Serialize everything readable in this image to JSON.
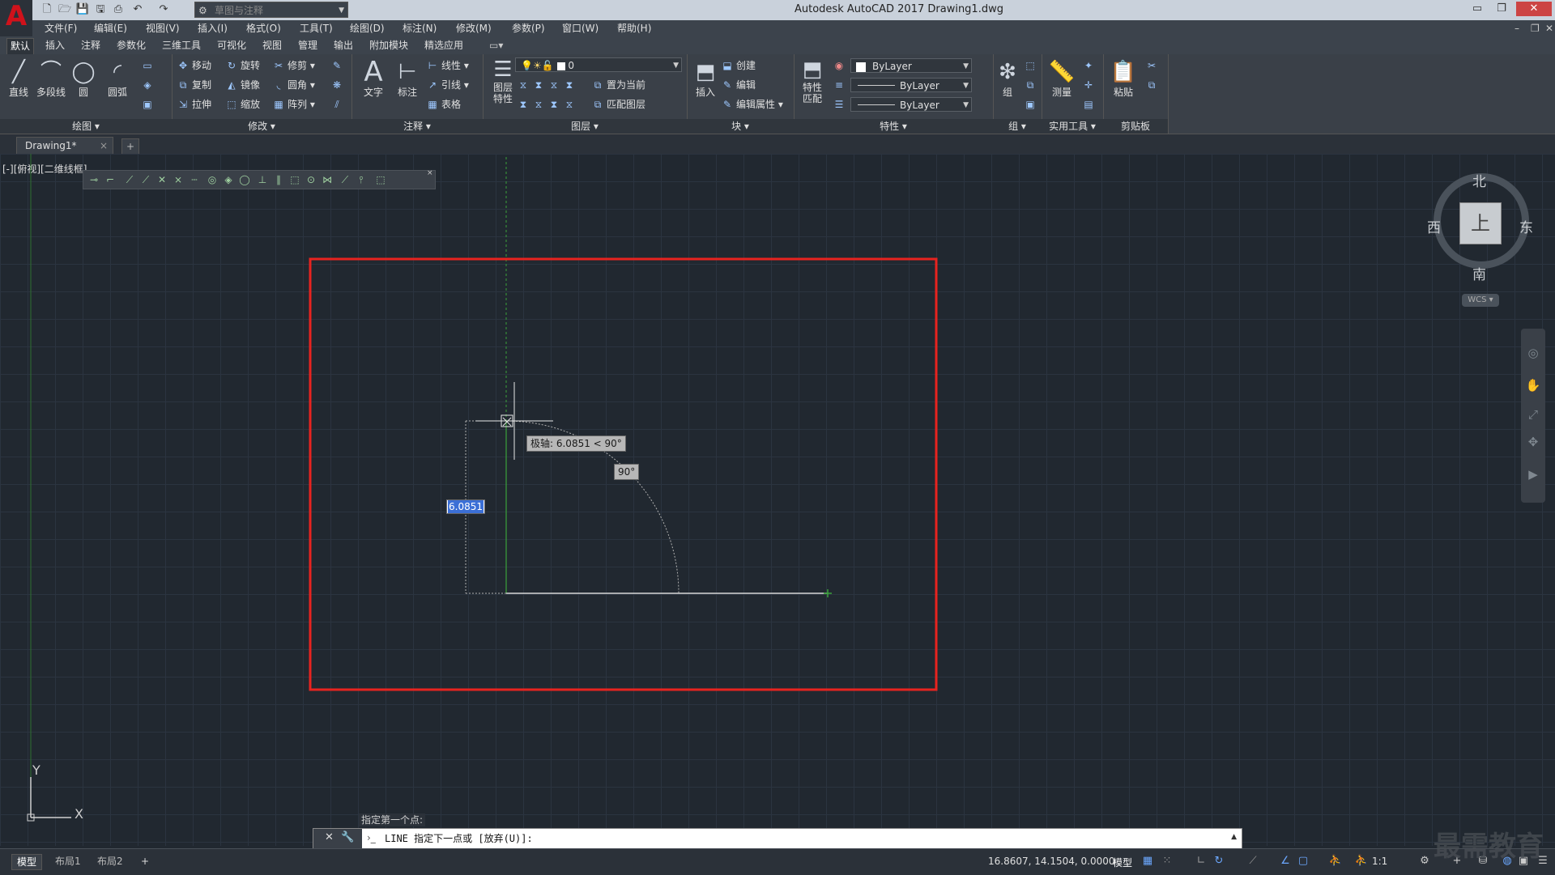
{
  "window": {
    "title": "Autodesk AutoCAD 2017    Drawing1.dwg",
    "workspace": "草图与注释",
    "app_logo": "A"
  },
  "menu": [
    "文件(F)",
    "编辑(E)",
    "视图(V)",
    "插入(I)",
    "格式(O)",
    "工具(T)",
    "绘图(D)",
    "标注(N)",
    "修改(M)",
    "参数(P)",
    "窗口(W)",
    "帮助(H)"
  ],
  "ribbon_tabs": [
    "默认",
    "插入",
    "注释",
    "参数化",
    "三维工具",
    "可视化",
    "视图",
    "管理",
    "输出",
    "附加模块",
    "精选应用"
  ],
  "ribbon": {
    "draw": {
      "title": "绘图",
      "line": "直线",
      "polyline": "多段线",
      "circle": "圆",
      "arc": "圆弧"
    },
    "modify": {
      "title": "修改",
      "move": "移动",
      "rotate": "旋转",
      "trim": "修剪",
      "copy": "复制",
      "mirror": "镜像",
      "fillet": "圆角",
      "stretch": "拉伸",
      "scale": "缩放",
      "array": "阵列"
    },
    "annotation": {
      "title": "注释",
      "text": "文字",
      "dimension": "标注",
      "linear": "线性",
      "leader": "引线",
      "table": "表格"
    },
    "layers": {
      "title": "图层",
      "layer_props_1": "图层",
      "layer_props_2": "特性",
      "current_layer": "0",
      "set_current": "置为当前",
      "match_layer": "匹配图层"
    },
    "block": {
      "title": "块",
      "insert": "插入",
      "create": "创建",
      "edit": "编辑",
      "edit_attr": "编辑属性"
    },
    "properties": {
      "title": "特性",
      "match_1": "特性",
      "match_2": "匹配",
      "color": "ByLayer",
      "linetype": "ByLayer",
      "lineweight": "ByLayer"
    },
    "group": {
      "title": "组",
      "group": "组"
    },
    "utilities": {
      "title": "实用工具",
      "measure": "测量"
    },
    "clipboard": {
      "title": "剪贴板",
      "paste": "粘贴"
    }
  },
  "doc_tab": {
    "name": "Drawing1*",
    "close": "×",
    "new": "+"
  },
  "viewport": {
    "label": "[-][俯视][二维线框]"
  },
  "viewcube": {
    "north": "北",
    "south": "南",
    "east": "东",
    "west": "西",
    "top": "上",
    "wcs": "WCS"
  },
  "tooltips": {
    "polar": "极轴: 6.0851 < 90°",
    "angle": "90°",
    "dynamic_input": "6.0851"
  },
  "command": {
    "hint": "指定第一个点:",
    "prompt": "LINE 指定下一点或 [放弃(U)]:"
  },
  "layout_tabs": [
    "模型",
    "布局1",
    "布局2"
  ],
  "status": {
    "coordinates": "16.8607, 14.1504, 0.0000",
    "model": "模型",
    "scale": "1:1"
  },
  "watermark": "最需教育",
  "colors": {
    "highlight_box": "#e8231f",
    "background": "#212830",
    "grid": "#2b3440",
    "ucs_y": "#3aa23a"
  }
}
